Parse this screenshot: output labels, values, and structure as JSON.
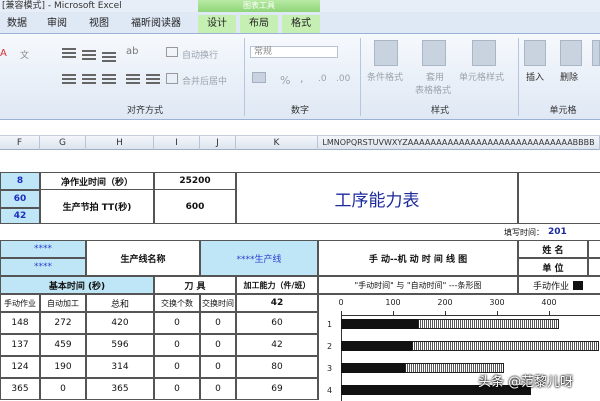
{
  "window": {
    "title": "[兼容模式] - Microsoft Excel",
    "context_tab": "图表工具"
  },
  "tabs": [
    "数据",
    "审阅",
    "视图",
    "福昕阅读器",
    "设计",
    "布局",
    "格式"
  ],
  "ribbon": {
    "wrap_text": "自动换行",
    "merge_center": "合并后居中",
    "number_format": "常规",
    "percent": "%",
    "comma": ",",
    "cond_format": "条件格式",
    "table_format_a": "套用",
    "table_format_b": "表格格式",
    "cell_styles": "单元格样式",
    "insert": "插入",
    "delete": "删除",
    "group_alignment": "对齐方式",
    "group_number": "数字",
    "group_styles": "样式",
    "group_cells": "单元格"
  },
  "columns": [
    "F",
    "G",
    "H",
    "I",
    "J",
    "K",
    "LMNOPQRSTUVWXYZAAAAAAAAAAAAAAAAAAAAAAAAAAAAABBBB"
  ],
  "sheet": {
    "top_left_vals": [
      "8",
      "60",
      "42"
    ],
    "net_work_time_label": "净作业时间（秒）",
    "net_work_time_value": "25200",
    "takt_label": "生产节拍 TT(秒)",
    "takt_value": "600",
    "main_title": "工序能力表",
    "fill_time_label": "填写时间：",
    "fill_time_value": "201",
    "stars1": "****",
    "stars2": "****",
    "line_name_label": "生产线名称",
    "line_name_value": "****生产线",
    "manual_machine_chart": "手 动--机 动 时 间 线 图",
    "name_label": "姓  名",
    "unit_label": "单  位",
    "basic_time": "基本时间 (秒)",
    "tool_label": "刀  具",
    "capacity_label": "加工能力（件/班）",
    "capacity_value": "42",
    "legend_text": "\"手动时间\" 与 \"自动时间\" ---条形图",
    "manual_op_label": "手动作业",
    "col_manual": "手动作业",
    "col_auto": "自动加工",
    "col_total": "总和",
    "col_swap_count": "交换个数",
    "col_swap_time": "交换时间",
    "rows": [
      {
        "manual": "148",
        "auto": "272",
        "total": "420",
        "swap_n": "0",
        "swap_t": "0",
        "cap": "60"
      },
      {
        "manual": "137",
        "auto": "459",
        "total": "596",
        "swap_n": "0",
        "swap_t": "0",
        "cap": "42"
      },
      {
        "manual": "124",
        "auto": "190",
        "total": "314",
        "swap_n": "0",
        "swap_t": "0",
        "cap": "80"
      },
      {
        "manual": "365",
        "auto": "0",
        "total": "365",
        "swap_n": "0",
        "swap_t": "0",
        "cap": "69"
      }
    ]
  },
  "chart_data": {
    "type": "bar",
    "categories": [
      "1",
      "2",
      "3",
      "4"
    ],
    "x_ticks": [
      "0",
      "100",
      "200",
      "300",
      "400",
      "500"
    ],
    "xlim": [
      0,
      500
    ],
    "series": [
      {
        "name": "手动时间",
        "values": [
          148,
          137,
          124,
          365
        ]
      },
      {
        "name": "自动时间",
        "values": [
          272,
          459,
          190,
          0
        ]
      }
    ]
  },
  "watermark": "头条 @范黎儿呀"
}
